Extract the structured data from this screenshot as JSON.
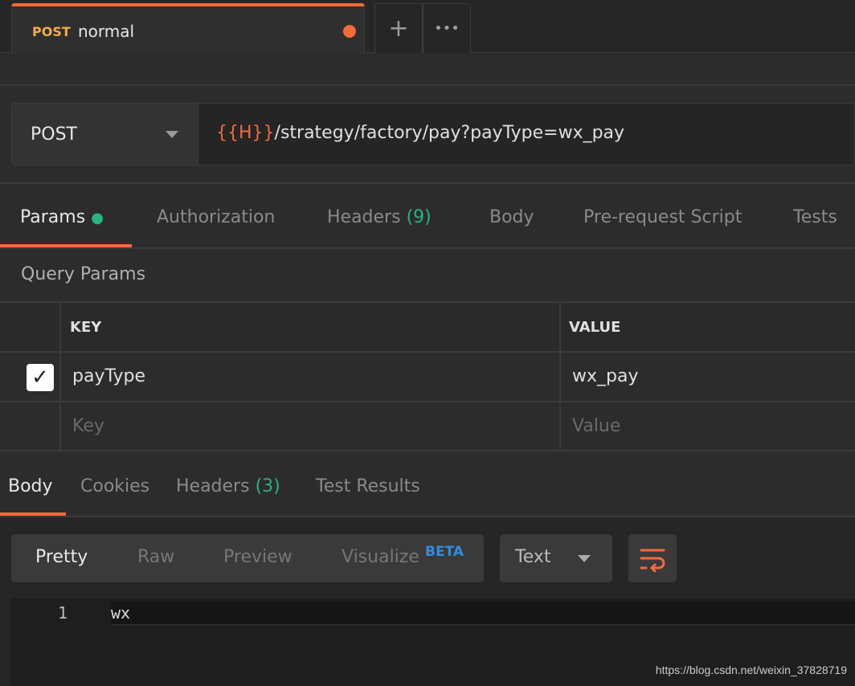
{
  "tab": {
    "method": "POST",
    "name": "normal",
    "unsaved_color": "#f26b3a"
  },
  "tab_actions": {
    "new": "+",
    "more": "•••"
  },
  "request": {
    "method": "POST",
    "url_variable": "{{H}}",
    "url_path": "/strategy/factory/pay?payType=wx_pay"
  },
  "request_tabs": [
    {
      "label": "Params"
    },
    {
      "label": "Authorization"
    },
    {
      "label": "Headers",
      "count": "(9)"
    },
    {
      "label": "Body"
    },
    {
      "label": "Pre-request Script"
    },
    {
      "label": "Tests"
    }
  ],
  "query_params": {
    "title": "Query Params",
    "columns": [
      "KEY",
      "VALUE"
    ],
    "rows": [
      {
        "checked": true,
        "key": "payType",
        "value": "wx_pay"
      }
    ],
    "placeholder": {
      "key": "Key",
      "value": "Value"
    }
  },
  "response_tabs": [
    {
      "label": "Body"
    },
    {
      "label": "Cookies"
    },
    {
      "label": "Headers",
      "count": "(3)"
    },
    {
      "label": "Test Results"
    }
  ],
  "view_modes": {
    "items": [
      "Pretty",
      "Raw",
      "Preview",
      "Visualize"
    ],
    "beta": "BETA",
    "selected": "Pretty"
  },
  "format": {
    "selected": "Text"
  },
  "editor": {
    "lines": [
      {
        "number": "1",
        "text": "wx"
      }
    ]
  },
  "watermark": "https://blog.csdn.net/weixin_37828719",
  "colors": {
    "accent": "#f26b3a",
    "method": "#f4b03e",
    "count": "#26b47f",
    "beta": "#2f8de4"
  }
}
